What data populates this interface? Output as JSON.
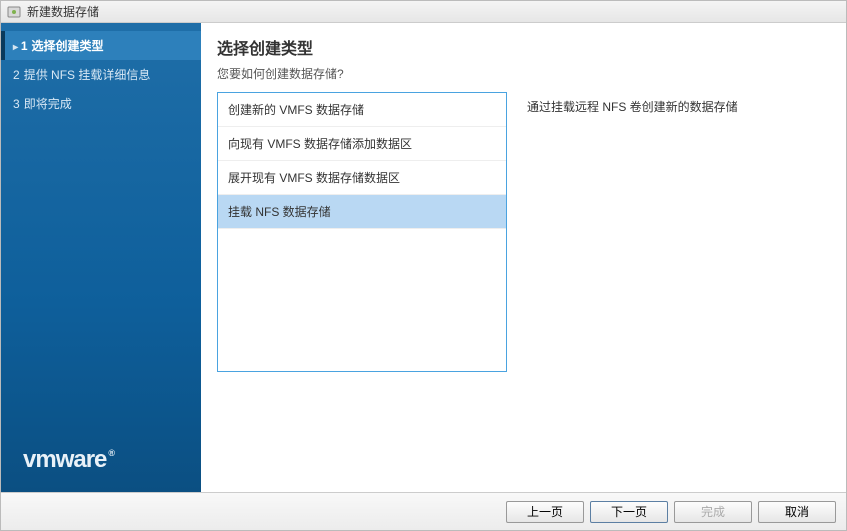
{
  "window": {
    "title": "新建数据存储"
  },
  "sidebar": {
    "steps": [
      {
        "num": "1",
        "label": "选择创建类型",
        "active": true
      },
      {
        "num": "2",
        "label": "提供 NFS 挂载详细信息",
        "active": false
      },
      {
        "num": "3",
        "label": "即将完成",
        "active": false
      }
    ],
    "logo": "vmware",
    "logo_reg": "®"
  },
  "main": {
    "title": "选择创建类型",
    "subtitle": "您要如何创建数据存储?",
    "options": [
      {
        "label": "创建新的 VMFS 数据存储",
        "selected": false
      },
      {
        "label": "向现有 VMFS 数据存储添加数据区",
        "selected": false
      },
      {
        "label": "展开现有 VMFS 数据存储数据区",
        "selected": false
      },
      {
        "label": "挂载 NFS 数据存储",
        "selected": true
      }
    ],
    "description": "通过挂载远程 NFS 卷创建新的数据存储"
  },
  "footer": {
    "back": "上一页",
    "next": "下一页",
    "finish": "完成",
    "cancel": "取消"
  },
  "icons": {
    "datastore": "datastore-icon"
  }
}
